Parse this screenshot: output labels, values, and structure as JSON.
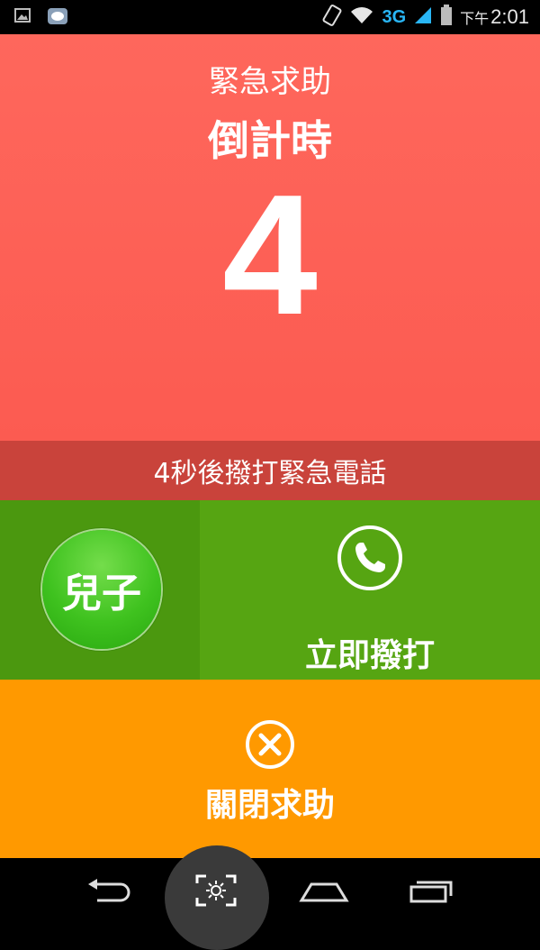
{
  "status_bar": {
    "time_prefix": "下午",
    "time": "2:01",
    "network": "3G",
    "icons": [
      "picture-icon",
      "messenger-icon",
      "rotate-icon",
      "wifi-icon",
      "signal-icon",
      "battery-icon"
    ]
  },
  "countdown": {
    "title": "緊急求助",
    "subtitle": "倒計時",
    "seconds": "4"
  },
  "notice": {
    "text": "4秒後撥打緊急電話"
  },
  "contact": {
    "name": "兒子"
  },
  "call": {
    "label": "立即撥打",
    "icon": "phone-icon"
  },
  "close": {
    "label": "關閉求助",
    "icon": "close-circle-icon"
  },
  "nav": {
    "icons": [
      "back-icon",
      "screen-capture-icon",
      "home-icon",
      "recent-apps-icon"
    ]
  },
  "colors": {
    "countdown_bg": "#fc5b51",
    "notice_bg": "#c9433b",
    "contact_bg": "#4b980f",
    "call_bg": "#56a512",
    "close_bg": "#ff9900"
  }
}
